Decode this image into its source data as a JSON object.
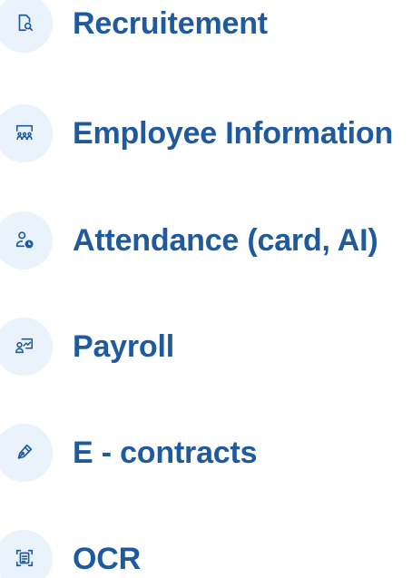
{
  "features": [
    {
      "label": "Recruitement",
      "icon": "document-search-icon"
    },
    {
      "label": "Employee Information",
      "icon": "group-users-icon"
    },
    {
      "label": "Attendance (card, AI)",
      "icon": "user-clock-icon"
    },
    {
      "label": "Payroll",
      "icon": "user-chart-icon"
    },
    {
      "label": "E - contracts",
      "icon": "pen-icon"
    },
    {
      "label": "OCR",
      "icon": "document-scan-icon"
    }
  ],
  "colors": {
    "accent": "#1f5a9e",
    "badge_background": "#eaf2fb"
  }
}
